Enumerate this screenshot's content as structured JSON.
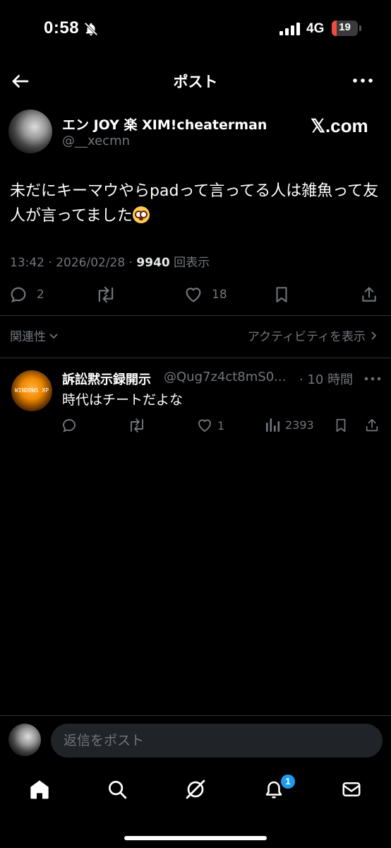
{
  "status": {
    "time": "0:58",
    "network": "4G",
    "battery": "19",
    "battery_level": 0.19
  },
  "header": {
    "title": "ポスト"
  },
  "post": {
    "author_name": "エン JOY 楽 XIM!cheaterman",
    "author_handle": "@__xecmn",
    "source_logo": "𝕏.com",
    "text": "未だにキーマウやらpadって言ってる人は雑魚って友人が言ってました",
    "time": "13:42 · 2026/02/28 · ",
    "views": "9940",
    "views_label": " 回表示",
    "actions": {
      "replies": "2",
      "likes": "18"
    }
  },
  "sort": {
    "label": "関連性",
    "activity": "アクティビティを表示"
  },
  "reply": {
    "name": "訴訟黙示録開示",
    "handle": "@Qug7z4ct8mS0...",
    "time": "· 10 時間",
    "text": "時代はチートだよな",
    "avatar_text": "WINDOWS XP",
    "actions": {
      "likes": "1",
      "views": "2393"
    }
  },
  "compose": {
    "placeholder": "返信をポスト"
  },
  "tabbar": {
    "notification_badge": "1"
  },
  "colors": {
    "background": "#000000",
    "muted": "#71767b",
    "accent": "#1d9bf0",
    "divider": "#2f3336"
  },
  "icons": [
    "back-arrow-icon",
    "more-icon",
    "reply-icon",
    "repost-icon",
    "like-icon",
    "bookmark-icon",
    "share-icon",
    "views-icon",
    "home-icon",
    "search-icon",
    "grok-icon",
    "notifications-icon",
    "messages-icon",
    "bell-off-icon",
    "signal-icon",
    "chevron-down-icon",
    "chevron-right-icon"
  ]
}
